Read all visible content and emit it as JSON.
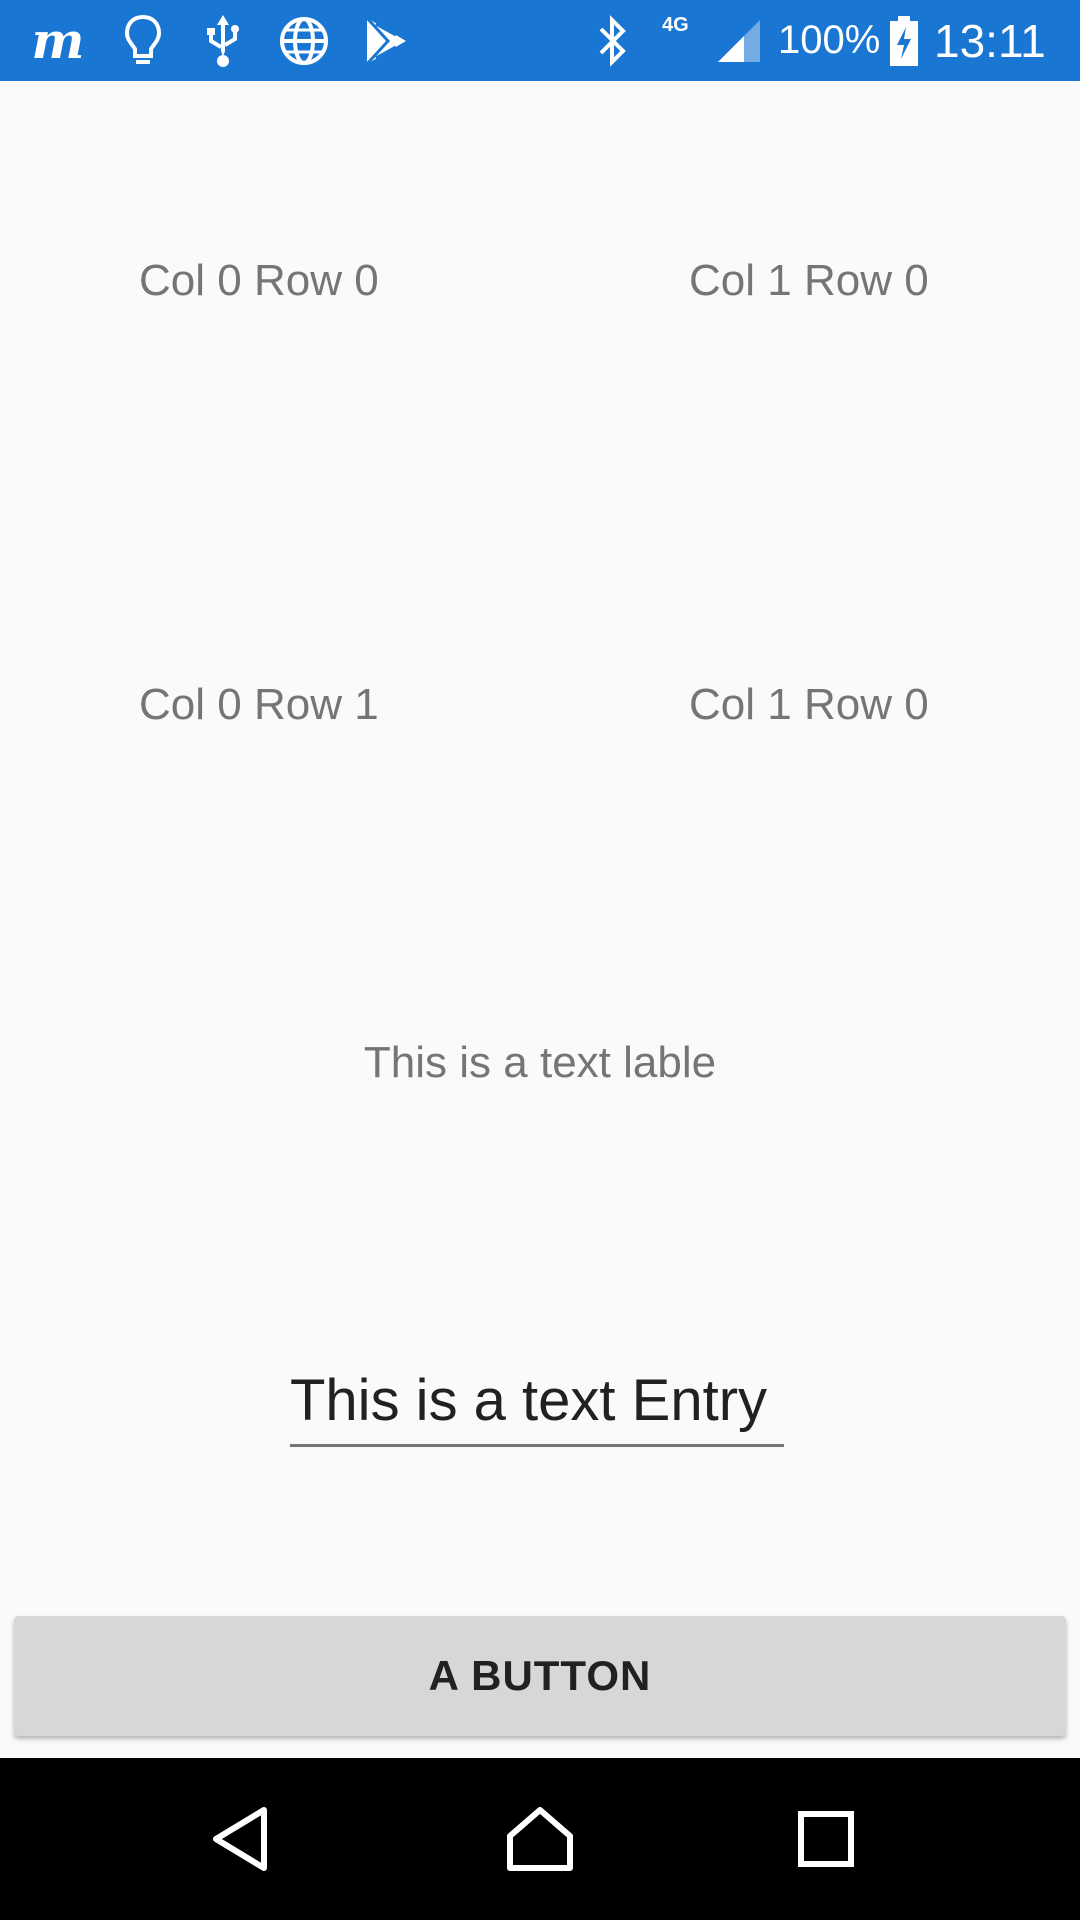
{
  "status_bar": {
    "network": "4G",
    "battery": "100%",
    "time": "13:11",
    "background_color": "#1976d2",
    "left_icons": [
      "m-logo-icon",
      "lightbulb-icon",
      "usb-icon",
      "globe-icon",
      "play-store-icon"
    ],
    "right_icons": [
      "bluetooth-icon",
      "signal-icon",
      "battery-charging-icon"
    ]
  },
  "grid": {
    "cells": [
      {
        "label": "Col 0 Row 0"
      },
      {
        "label": "Col 1 Row 0"
      },
      {
        "label": "Col 0 Row 1"
      },
      {
        "label": "Col 1 Row 0"
      }
    ]
  },
  "text_label": "This is a text lable",
  "entry": {
    "value": "This is a text Entry"
  },
  "button": {
    "label": "A BUTTON"
  },
  "nav_bar": {
    "icons": [
      "back-icon",
      "home-icon",
      "recents-icon"
    ]
  }
}
